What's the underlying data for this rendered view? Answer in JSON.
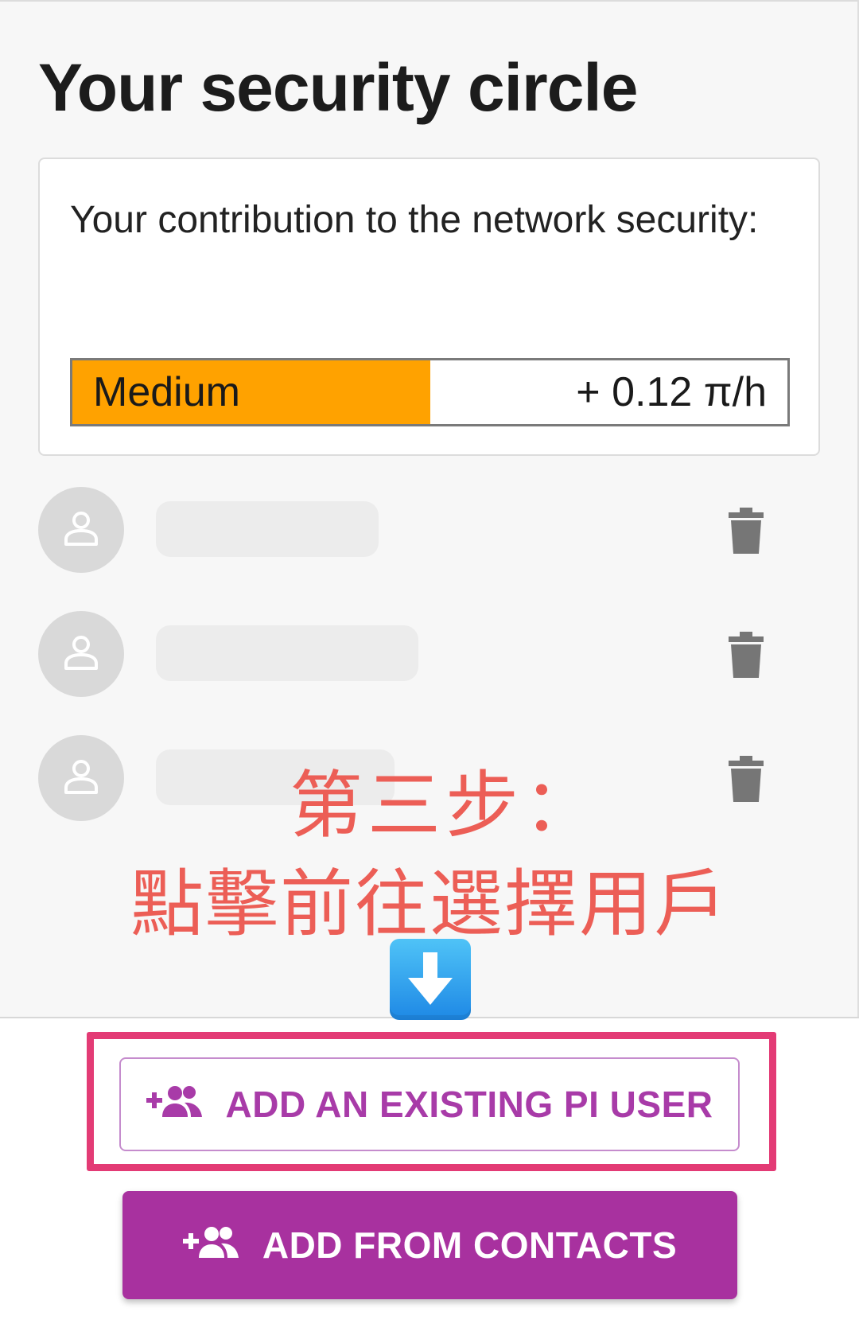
{
  "page": {
    "title": "Your security circle"
  },
  "contribution": {
    "description": "Your contribution to the network security:",
    "level_label": "Medium",
    "level_fraction": 0.5,
    "rate": "+ 0.12 π/h",
    "level_color": "#ffa200"
  },
  "members": [
    {
      "name": "",
      "avatar_icon": "person-icon",
      "delete_icon": "trash-icon"
    },
    {
      "name": "",
      "avatar_icon": "person-icon",
      "delete_icon": "trash-icon"
    },
    {
      "name": "",
      "avatar_icon": "person-icon",
      "delete_icon": "trash-icon"
    }
  ],
  "annotation": {
    "line1": "第三步：",
    "line2": "點擊前往選擇用戶",
    "arrow_icon": "down-arrow-emoji-icon",
    "color": "#ec5e56",
    "highlight_color": "#e33b75"
  },
  "actions": {
    "add_existing_label": "ADD AN EXISTING PI USER",
    "add_contacts_label": "ADD FROM CONTACTS",
    "add_icon": "add-people-icon",
    "accent_color": "#a8319f"
  }
}
